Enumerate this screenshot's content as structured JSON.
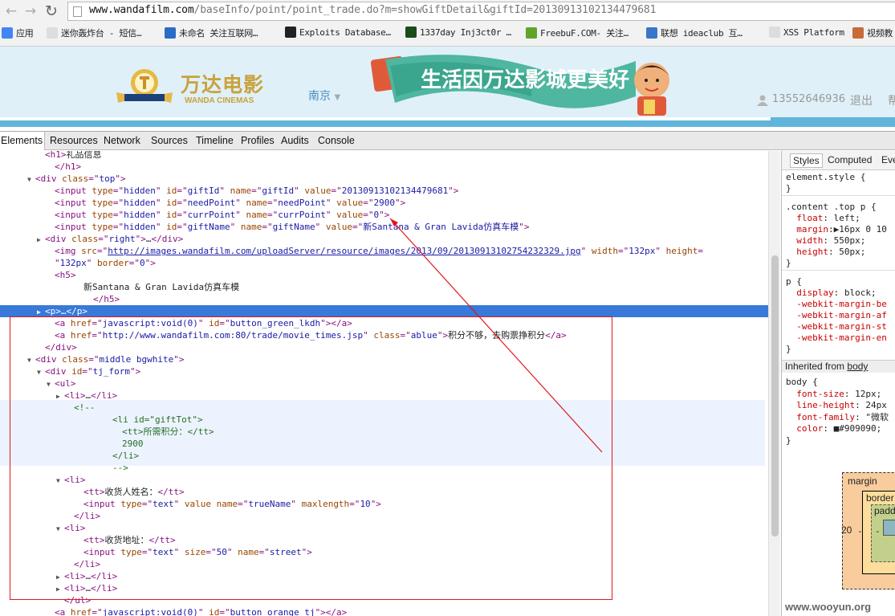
{
  "browser": {
    "url_host": "www.wandafilm.com",
    "url_rest": "/baseInfo/point/point_trade.do?m=showGiftDetail&giftId=20130913102134479681",
    "bookmarks": [
      {
        "label": "应用",
        "icon_color": "#4285f4"
      },
      {
        "label": "迷你轰炸台 - 短信…",
        "icon_color": "#ddd"
      },
      {
        "label": "未命名 关注互联网…",
        "icon_color": "#2b6cc4"
      },
      {
        "label": "Exploits Database…",
        "icon_color": "#222"
      },
      {
        "label": "1337day Inj3ct0r …",
        "icon_color": "#1a4d1a"
      },
      {
        "label": "FreebuF.COM- 关注…",
        "icon_color": "#5fa52a"
      },
      {
        "label": "联想 ideaclub 互…",
        "icon_color": "#3a76c8"
      },
      {
        "label": "XSS Platform",
        "icon_color": "#ddd"
      },
      {
        "label": "视频教",
        "icon_color": "#c86a3a"
      }
    ]
  },
  "site": {
    "logo_cn": "万达电影",
    "logo_en": "WANDA CINEMAS",
    "city": "南京",
    "city_arrow": "▼",
    "banner_text": "生活因万达影城更美好",
    "phone": "13552646936",
    "logout": "退出",
    "help": "帮"
  },
  "devtools": {
    "tabs": [
      "Elements",
      "Resources",
      "Network",
      "Sources",
      "Timeline",
      "Profiles",
      "Audits",
      "Console"
    ],
    "active_tab": "Elements",
    "styles_tabs": [
      "Styles",
      "Computed",
      "Eve"
    ],
    "element_lines": [
      {
        "indent": 4,
        "tri": "",
        "html": "<span class='tag'>&lt;h1&gt;</span>礼品信息"
      },
      {
        "indent": 5,
        "tri": "",
        "html": "<span class='tag'>&lt;/h1&gt;</span>"
      },
      {
        "indent": 3,
        "tri": "▼",
        "html": "<span class='tag'>&lt;div </span><span class='attr'>class</span><span class='tag'>=\"</span><span class='val'>top</span><span class='tag'>\"&gt;</span>"
      },
      {
        "indent": 5,
        "tri": "",
        "html": "<span class='tag'>&lt;input </span><span class='attr'>type</span><span class='tag'>=\"</span><span class='val'>hidden</span><span class='tag'>\" </span><span class='attr'>id</span><span class='tag'>=\"</span><span class='val'>giftId</span><span class='tag'>\" </span><span class='attr'>name</span><span class='tag'>=\"</span><span class='val'>giftId</span><span class='tag'>\" </span><span class='attr'>value</span><span class='tag'>=\"</span><span class='val'>20130913102134479681</span><span class='tag'>\"&gt;</span>"
      },
      {
        "indent": 5,
        "tri": "",
        "html": "<span class='tag'>&lt;input </span><span class='attr'>type</span><span class='tag'>=\"</span><span class='val'>hidden</span><span class='tag'>\" </span><span class='attr'>id</span><span class='tag'>=\"</span><span class='val'>needPoint</span><span class='tag'>\" </span><span class='attr'>name</span><span class='tag'>=\"</span><span class='val'>needPoint</span><span class='tag'>\" </span><span class='attr'>value</span><span class='tag'>=\"</span><span class='val'>2900</span><span class='tag'>\"&gt;</span>"
      },
      {
        "indent": 5,
        "tri": "",
        "html": "<span class='tag'>&lt;input </span><span class='attr'>type</span><span class='tag'>=\"</span><span class='val'>hidden</span><span class='tag'>\" </span><span class='attr'>id</span><span class='tag'>=\"</span><span class='val'>currPoint</span><span class='tag'>\" </span><span class='attr'>name</span><span class='tag'>=\"</span><span class='val'>currPoint</span><span class='tag'>\" </span><span class='attr'>value</span><span class='tag'>=\"</span><span class='val'>0</span><span class='tag'>\"&gt;</span>"
      },
      {
        "indent": 5,
        "tri": "",
        "html": "<span class='tag'>&lt;input </span><span class='attr'>type</span><span class='tag'>=\"</span><span class='val'>hidden</span><span class='tag'>\" </span><span class='attr'>id</span><span class='tag'>=\"</span><span class='val'>giftName</span><span class='tag'>\" </span><span class='attr'>name</span><span class='tag'>=\"</span><span class='val'>giftName</span><span class='tag'>\" </span><span class='attr'>value</span><span class='tag'>=\"</span><span class='val'>新Santana &amp; Gran Lavida仿真车模</span><span class='tag'>\"&gt;</span>"
      },
      {
        "indent": 4,
        "tri": "▶",
        "html": "<span class='tag'>&lt;div </span><span class='attr'>class</span><span class='tag'>=\"</span><span class='val'>right</span><span class='tag'>\"&gt;</span>…<span class='tag'>&lt;/div&gt;</span>"
      },
      {
        "indent": 5,
        "tri": "",
        "html": "<span class='tag'>&lt;img </span><span class='attr'>src</span><span class='tag'>=\"</span><span class='link'>http://images.wandafilm.com/uploadServer/resource/images/2013/09/20130913102754232329.jpg</span><span class='tag'>\" </span><span class='attr'>width</span><span class='tag'>=\"</span><span class='val'>132px</span><span class='tag'>\" </span><span class='attr'>height</span><span class='tag'>=</span>"
      },
      {
        "indent": 5,
        "tri": "",
        "html": "<span class='tag'>\"</span><span class='val'>132px</span><span class='tag'>\" </span><span class='attr'>border</span><span class='tag'>=\"</span><span class='val'>0</span><span class='tag'>\"&gt;</span>"
      },
      {
        "indent": 5,
        "tri": "",
        "html": "<span class='tag'>&lt;h5&gt;</span>"
      },
      {
        "indent": 8,
        "tri": "",
        "html": "新Santana &amp; Gran Lavida仿真车模"
      },
      {
        "indent": 9,
        "tri": "",
        "html": "<span class='tag'>&lt;/h5&gt;</span>"
      },
      {
        "indent": 4,
        "tri": "▶",
        "html": "<span class='tag'>&lt;p&gt;</span>…<span class='tag'>&lt;/p&gt;</span>",
        "selected": true
      },
      {
        "indent": 5,
        "tri": "",
        "html": "<span class='tag'>&lt;a </span><span class='attr'>href</span><span class='tag'>=\"</span><span class='val'>javascript:void(0)</span><span class='tag'>\" </span><span class='attr'>id</span><span class='tag'>=\"</span><span class='val'>button_green_lkdh</span><span class='tag'>\"&gt;&lt;/a&gt;</span>"
      },
      {
        "indent": 5,
        "tri": "",
        "html": "<span class='tag'>&lt;a </span><span class='attr'>href</span><span class='tag'>=\"</span><span class='val'>http://www.wandafilm.com:80/trade/movie_times.jsp</span><span class='tag'>\" </span><span class='attr'>class</span><span class='tag'>=\"</span><span class='val'>ablue</span><span class='tag'>\"&gt;</span>积分不够，去购票挣积分<span class='tag'>&lt;/a&gt;</span>"
      },
      {
        "indent": 4,
        "tri": "",
        "html": "<span class='tag'>&lt;/div&gt;</span>"
      },
      {
        "indent": 3,
        "tri": "▼",
        "html": "<span class='tag'>&lt;div </span><span class='attr'>class</span><span class='tag'>=\"</span><span class='val'>middle bgwhite</span><span class='tag'>\"&gt;</span>"
      },
      {
        "indent": 4,
        "tri": "▼",
        "html": "<span class='tag'>&lt;div </span><span class='attr'>id</span><span class='tag'>=\"</span><span class='val'>tj_form</span><span class='tag'>\"&gt;</span>"
      },
      {
        "indent": 5,
        "tri": "▼",
        "html": "<span class='tag'>&lt;ul&gt;</span>"
      },
      {
        "indent": 6,
        "tri": "▶",
        "html": "<span class='tag'>&lt;li&gt;</span>…<span class='tag'>&lt;/li&gt;</span>"
      },
      {
        "indent": 7,
        "tri": "",
        "html": "<span class='cmt'>&lt;!--</span>"
      },
      {
        "indent": 11,
        "tri": "",
        "html": "<span class='cmt'>&lt;li id=\"giftTot\"&gt;</span>"
      },
      {
        "indent": 12,
        "tri": "",
        "html": "<span class='cmt'>&lt;tt&gt;所需积分：&lt;/tt&gt;</span>"
      },
      {
        "indent": 12,
        "tri": "",
        "html": "<span class='cmt'>2900</span>"
      },
      {
        "indent": 11,
        "tri": "",
        "html": "<span class='cmt'>&lt;/li&gt;</span>"
      },
      {
        "indent": 11,
        "tri": "",
        "html": "<span class='cmt'>--&gt;</span>"
      },
      {
        "indent": 6,
        "tri": "▼",
        "html": "<span class='tag'>&lt;li&gt;</span>"
      },
      {
        "indent": 8,
        "tri": "",
        "html": "<span class='tag'>&lt;tt&gt;</span>收货人姓名：<span class='tag'>&lt;/tt&gt;</span>"
      },
      {
        "indent": 8,
        "tri": "",
        "html": "<span class='tag'>&lt;input </span><span class='attr'>type</span><span class='tag'>=\"</span><span class='val'>text</span><span class='tag'>\" </span><span class='attr'>value name</span><span class='tag'>=\"</span><span class='val'>trueName</span><span class='tag'>\" </span><span class='attr'>maxlength</span><span class='tag'>=\"</span><span class='val'>10</span><span class='tag'>\"&gt;</span>"
      },
      {
        "indent": 7,
        "tri": "",
        "html": "<span class='tag'>&lt;/li&gt;</span>"
      },
      {
        "indent": 6,
        "tri": "▼",
        "html": "<span class='tag'>&lt;li&gt;</span>"
      },
      {
        "indent": 8,
        "tri": "",
        "html": "<span class='tag'>&lt;tt&gt;</span>收货地址：<span class='tag'>&lt;/tt&gt;</span>"
      },
      {
        "indent": 8,
        "tri": "",
        "html": "<span class='tag'>&lt;input </span><span class='attr'>type</span><span class='tag'>=\"</span><span class='val'>text</span><span class='tag'>\" </span><span class='attr'>size</span><span class='tag'>=\"</span><span class='val'>50</span><span class='tag'>\" </span><span class='attr'>name</span><span class='tag'>=\"</span><span class='val'>street</span><span class='tag'>\"&gt;</span>"
      },
      {
        "indent": 7,
        "tri": "",
        "html": "<span class='tag'>&lt;/li&gt;</span>"
      },
      {
        "indent": 6,
        "tri": "▶",
        "html": "<span class='tag'>&lt;li&gt;</span>…<span class='tag'>&lt;/li&gt;</span>"
      },
      {
        "indent": 6,
        "tri": "▶",
        "html": "<span class='tag'>&lt;li&gt;</span>…<span class='tag'>&lt;/li&gt;</span>"
      },
      {
        "indent": 6,
        "tri": "",
        "html": "<span class='tag'>&lt;/ul&gt;</span>"
      },
      {
        "indent": 5,
        "tri": "",
        "html": "<span class='tag'>&lt;a </span><span class='attr'>href</span><span class='tag'>=\"</span><span class='val'>javascript:void(0)</span><span class='tag'>\" </span><span class='attr'>id</span><span class='tag'>=\"</span><span class='val'>button_orange_tj</span><span class='tag'>\"&gt;&lt;/a&gt;</span>"
      }
    ],
    "styles_lines": [
      {
        "html": "element.style {"
      },
      {
        "html": "}"
      },
      {
        "html": ".content .top p {"
      },
      {
        "html": "  <span class='prop'>float</span>: <span class='pval'>left;</span>"
      },
      {
        "html": "  <span class='prop'>margin</span>:▶<span class='pval'>16px 0 10</span>"
      },
      {
        "html": "  <span class='prop'>width</span>: <span class='pval'>550px;</span>"
      },
      {
        "html": "  <span class='prop'>height</span>: <span class='pval'>50px;</span>"
      },
      {
        "html": "}"
      },
      {
        "html": "p {"
      },
      {
        "html": "  <span class='prop'>display</span>: <span class='pval'>block;</span>"
      },
      {
        "html": "  <span class='prop'>-webkit-margin-be</span>"
      },
      {
        "html": "  <span class='prop'>-webkit-margin-af</span>"
      },
      {
        "html": "  <span class='prop'>-webkit-margin-st</span>"
      },
      {
        "html": "  <span class='prop'>-webkit-margin-en</span>"
      },
      {
        "html": "}"
      }
    ],
    "inherited_label": "Inherited from",
    "inherited_from": "body",
    "body_lines": [
      {
        "html": "body {"
      },
      {
        "html": "  <span class='prop'>font-size</span>: <span class='pval'>12px;</span>"
      },
      {
        "html": "  <span class='prop'>line-height</span>: <span class='pval'>24px</span>"
      },
      {
        "html": "  <span class='prop'>font-family</span>: <span class='pval'>\"微软</span>"
      },
      {
        "html": "  <span class='prop'>color</span>: <span class='pval'>■#909090;</span>"
      },
      {
        "html": "}"
      }
    ],
    "boxmodel": {
      "margin": "margin",
      "border": "border",
      "padding": "padd",
      "left_margin": "20",
      "dash": "-"
    }
  },
  "watermark": "www.wooyun.org"
}
